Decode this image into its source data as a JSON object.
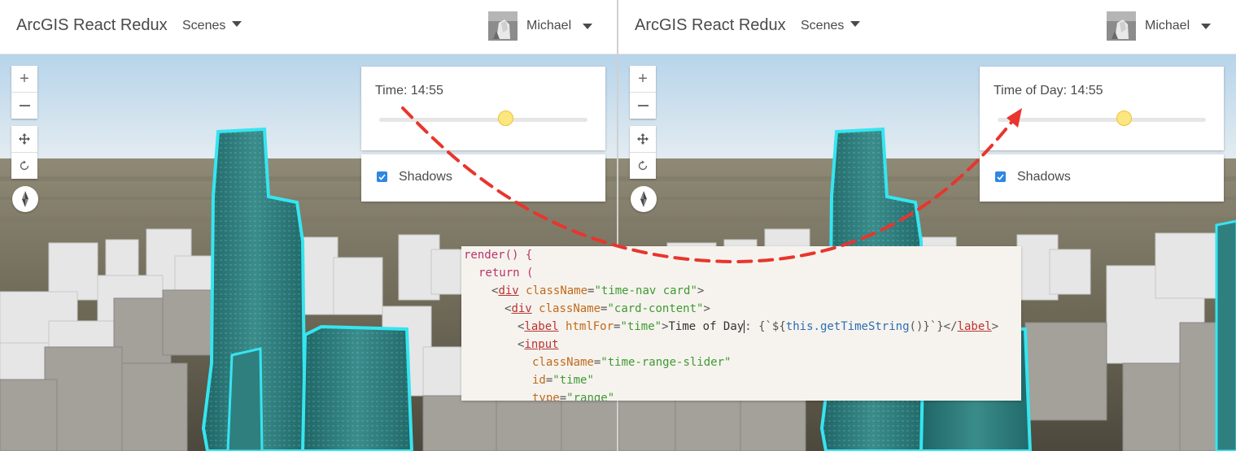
{
  "app": {
    "title": "ArcGIS React Redux",
    "scenes_label": "Scenes",
    "user_name": "Michael"
  },
  "map_controls": {
    "zoom_in_glyph": "+",
    "zoom_out_glyph": "—",
    "pan_icon": "move-arrows-icon",
    "rotate_icon": "rotate-icon",
    "compass_icon": "compass-icon"
  },
  "left_panel": {
    "time_label": "Time: 14:55",
    "slider_fraction": 0.61,
    "shadows_label": "Shadows",
    "shadows_checked": true
  },
  "right_panel": {
    "time_label": "Time of Day: 14:55",
    "slider_fraction": 0.61,
    "shadows_label": "Shadows",
    "shadows_checked": true
  },
  "code": {
    "line1": "render() {",
    "line2": "return (",
    "line3_tag": "div",
    "line3_attr": "className",
    "line3_value": "\"time-nav card\"",
    "line4_tag": "div",
    "line4_attr": "className",
    "line4_value": "\"card-content\"",
    "line5_tag": "label",
    "line5_attr": "htmlFor",
    "line5_value": "\"time\"",
    "line5_text": "Time of Day",
    "line5_expr_a": ": {`${",
    "line5_expr_this": "this",
    "line5_expr_fn": ".getTimeString",
    "line5_expr_b": "()}`}</",
    "line6_tag": "input",
    "line7_attr": "className",
    "line7_value": "\"time-range-slider\"",
    "line8_attr": "id",
    "line8_value": "\"time\"",
    "line9_attr": "type",
    "line9_value": "\"range\""
  },
  "colors": {
    "highlight": "#36e5f0",
    "building_glass": "#2f7f7f",
    "arrow": "#e8352d",
    "slider_thumb": "#fbe67f",
    "checkbox": "#2e87e0"
  }
}
